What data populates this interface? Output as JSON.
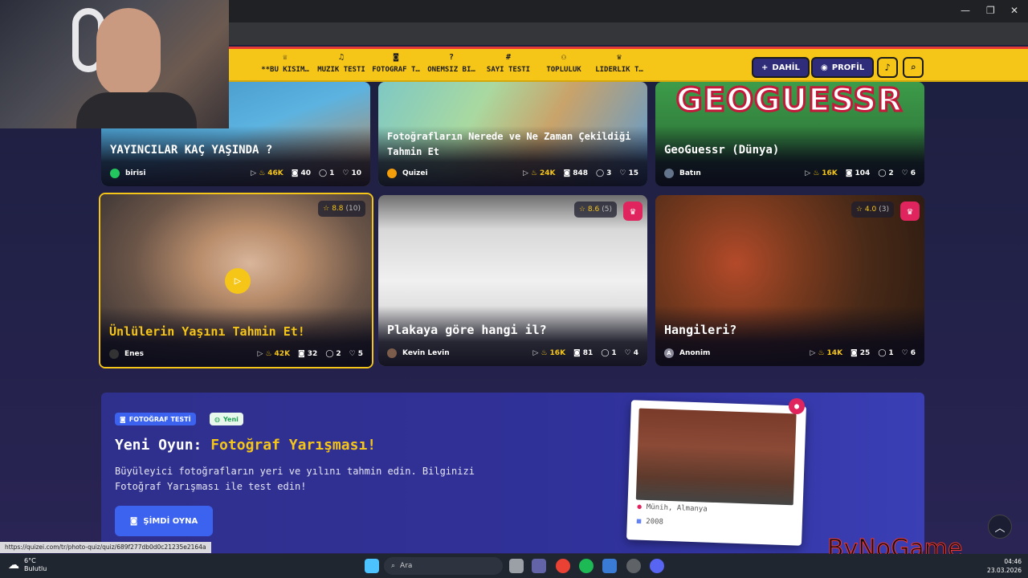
{
  "window": {
    "minimize": "—",
    "maximize": "❐",
    "close": "✕"
  },
  "nav": {
    "items": [
      {
        "label": "**BU KISIM…",
        "icon": "trophy-icon",
        "glyph": "♕"
      },
      {
        "label": "MÜZİK TESTİ",
        "icon": "music-icon",
        "glyph": "♫"
      },
      {
        "label": "FOTOĞRAF T…",
        "icon": "camera-icon",
        "glyph": "◙"
      },
      {
        "label": "ÖNEMSİZ Bİ…",
        "icon": "question-icon",
        "glyph": "?"
      },
      {
        "label": "SAYI TESTİ",
        "icon": "hash-icon",
        "glyph": "#"
      },
      {
        "label": "TOPLULUK",
        "icon": "users-icon",
        "glyph": "⚇"
      },
      {
        "label": "LİDERLİK T…",
        "icon": "medal-icon",
        "glyph": "♛"
      }
    ],
    "join_label": "DAHİL",
    "profile_label": "PROFİL"
  },
  "cards": [
    {
      "title": "YAYINCILAR KAÇ YAŞINDA ?",
      "author": "birisi",
      "views": "46K",
      "photos": "40",
      "comments": "1",
      "likes": "10"
    },
    {
      "title": "Fotoğrafların Nerede ve Ne Zaman Çekildiği Tahmin Et",
      "author": "Quizei",
      "views": "24K",
      "photos": "848",
      "comments": "3",
      "likes": "15"
    },
    {
      "title": "GeoGuessr (Dünya)",
      "logo": "GEOGUESSR",
      "author": "Batın",
      "views": "16K",
      "photos": "104",
      "comments": "2",
      "likes": "6"
    },
    {
      "title": "Ünlülerin Yaşını Tahmin Et!",
      "author": "Enes",
      "views": "42K",
      "photos": "32",
      "comments": "2",
      "likes": "5",
      "rating": "8.8",
      "rating_count": "(10)"
    },
    {
      "title": "Plakaya göre hangi il?",
      "author": "Kevin Levin",
      "views": "16K",
      "photos": "81",
      "comments": "1",
      "likes": "4",
      "rating": "8.6",
      "rating_count": "(5)"
    },
    {
      "title": "Hangileri?",
      "author": "Anonim",
      "author_initial": "A",
      "views": "14K",
      "photos": "25",
      "comments": "1",
      "likes": "6",
      "rating": "4.0",
      "rating_count": "(3)"
    }
  ],
  "promo": {
    "badge": "FOTOĞRAF TESTİ",
    "new_badge": "Yeni",
    "title_prefix": "Yeni Oyun:",
    "title_highlight": "Fotoğraf Yarışması!",
    "description": "Büyüleyici fotoğrafların yeri ve yılını tahmin edin. Bilginizi Fotoğraf Yarışması ile test edin!",
    "button_label": "ŞİMDİ OYNA",
    "photo_location": "Münih, Almanya",
    "photo_year": "2008"
  },
  "status_url": "https://quizei.com/tr/photo-quiz/quiz/689f277db0d0c21235e2164a",
  "watermark": "ByNoGame",
  "taskbar": {
    "temperature": "6°C",
    "weather": "Bulutlu",
    "search_placeholder": "Ara",
    "time": "04:46",
    "date": "23.03.2026"
  },
  "colors": {
    "accent": "#f5c518",
    "brand_red": "#e0245e",
    "button_blue": "#3b63f0"
  }
}
